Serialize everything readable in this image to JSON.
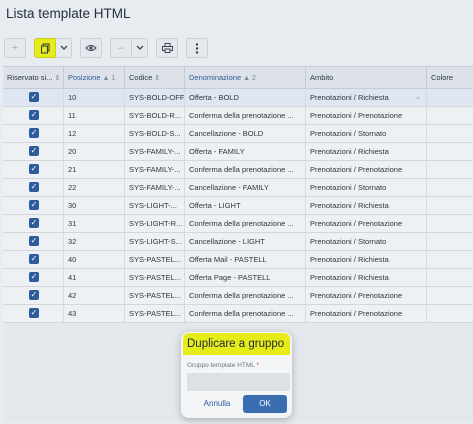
{
  "page": {
    "title": "Lista template HTML"
  },
  "toolbar": {
    "add_icon": "plus-icon",
    "duplicate_icon": "copy-icon",
    "view_icon": "eye-icon",
    "print_icon": "printer-icon",
    "more_icon": "vertical-dots-icon",
    "highlight_color": "#e5ec1a"
  },
  "grid": {
    "columns": [
      {
        "label": "Riservato si...",
        "sort": "⇕"
      },
      {
        "label": "Posizione",
        "sort": "▲ 1"
      },
      {
        "label": "Codice",
        "sort": "⇕"
      },
      {
        "label": "Denominazione",
        "sort": "▲ 2"
      },
      {
        "label": "Ambito",
        "sort": ""
      },
      {
        "label": "Colore",
        "sort": ""
      }
    ],
    "rows": [
      {
        "riservato": true,
        "posizione": "10",
        "codice": "SYS-BOLD-OFF",
        "denominazione": "Offerta - BOLD",
        "ambito": "Prenotazioni / Richiesta",
        "colore": ""
      },
      {
        "riservato": true,
        "posizione": "11",
        "codice": "SYS-BOLD-R...",
        "denominazione": "Conferma della prenotazione ...",
        "ambito": "Prenotazioni / Prenotazione",
        "colore": ""
      },
      {
        "riservato": true,
        "posizione": "12",
        "codice": "SYS-BOLD-S...",
        "denominazione": "Cancellazione - BOLD",
        "ambito": "Prenotazioni / Stornato",
        "colore": ""
      },
      {
        "riservato": true,
        "posizione": "20",
        "codice": "SYS-FAMILY-...",
        "denominazione": "Offerta - FAMILY",
        "ambito": "Prenotazioni / Richiesta",
        "colore": ""
      },
      {
        "riservato": true,
        "posizione": "21",
        "codice": "SYS-FAMILY-...",
        "denominazione": "Conferma della prenotazione ...",
        "ambito": "Prenotazioni / Prenotazione",
        "colore": ""
      },
      {
        "riservato": true,
        "posizione": "22",
        "codice": "SYS-FAMILY-...",
        "denominazione": "Cancellazione - FAMILY",
        "ambito": "Prenotazioni / Stornato",
        "colore": ""
      },
      {
        "riservato": true,
        "posizione": "30",
        "codice": "SYS-LIGHT-...",
        "denominazione": "Offerta - LIGHT",
        "ambito": "Prenotazioni / Richiesta",
        "colore": ""
      },
      {
        "riservato": true,
        "posizione": "31",
        "codice": "SYS-LIGHT-R...",
        "denominazione": "Conferma della prenotazione ...",
        "ambito": "Prenotazioni / Prenotazione",
        "colore": ""
      },
      {
        "riservato": true,
        "posizione": "32",
        "codice": "SYS-LIGHT-S...",
        "denominazione": "Cancellazione - LIGHT",
        "ambito": "Prenotazioni / Stornato",
        "colore": ""
      },
      {
        "riservato": true,
        "posizione": "40",
        "codice": "SYS-PASTEL...",
        "denominazione": "Offerta Mail - PASTELL",
        "ambito": "Prenotazioni / Richiesta",
        "colore": ""
      },
      {
        "riservato": true,
        "posizione": "41",
        "codice": "SYS-PASTEL...",
        "denominazione": "Offerta Page - PASTELL",
        "ambito": "Prenotazioni / Richiesta",
        "colore": ""
      },
      {
        "riservato": true,
        "posizione": "42",
        "codice": "SYS-PASTEL...",
        "denominazione": "Conferma della prenotazione ...",
        "ambito": "Prenotazioni / Prenotazione",
        "colore": ""
      },
      {
        "riservato": true,
        "posizione": "43",
        "codice": "SYS-PASTEL...",
        "denominazione": "Conferma della prenotazione ...",
        "ambito": "Prenotazioni / Prenotazione",
        "colore": ""
      }
    ]
  },
  "modal": {
    "title": "Duplicare a gruppo",
    "field_label": "Gruppo template HTML",
    "required_mark": "*",
    "field_value": "",
    "cancel_label": "Annulla",
    "ok_label": "OK"
  }
}
